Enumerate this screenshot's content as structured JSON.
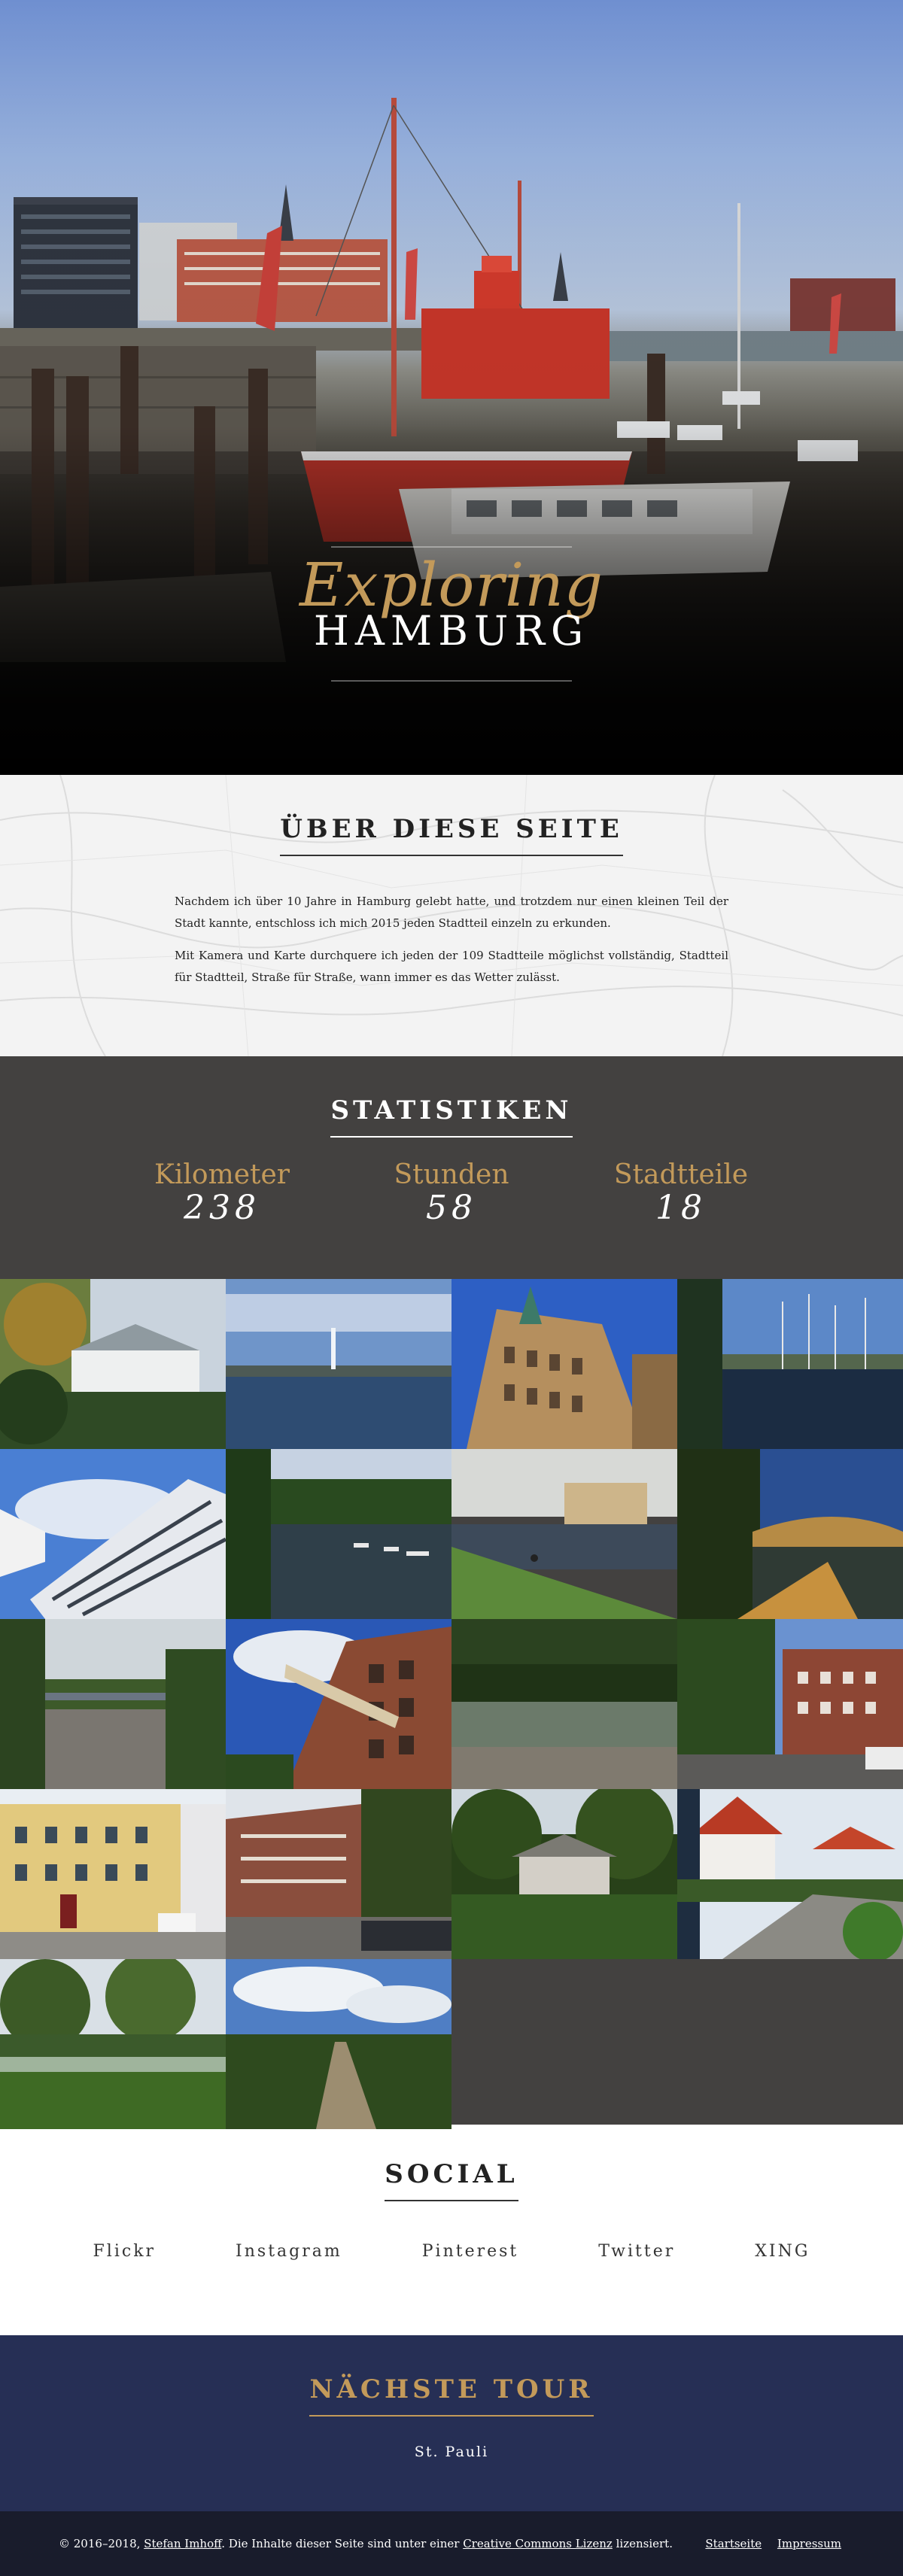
{
  "hero": {
    "script_title": "Exploring",
    "main_title": "HAMBURG"
  },
  "about": {
    "title": "ÜBER DIESE SEITE",
    "paragraphs": [
      "Nachdem ich über 10 Jahre in Hamburg gelebt hatte, und trotzdem nur einen kleinen Teil der Stadt kannte, entschloss ich mich 2015 jeden Stadtteil einzeln zu erkunden.",
      "Mit Kamera und Karte durchquere ich jeden der 109 Stadtteile möglichst vollständig, Stadtteil für Stadtteil, Straße für Straße, wann immer es das Wetter zulässt."
    ]
  },
  "stats": {
    "title": "STATISTIKEN",
    "items": [
      {
        "label": "Kilometer",
        "value": "238"
      },
      {
        "label": "Stunden",
        "value": "58"
      },
      {
        "label": "Stadtteile",
        "value": "18"
      }
    ]
  },
  "gallery": {
    "photos": [
      {
        "scene": "villa-trees"
      },
      {
        "scene": "alster-fountain"
      },
      {
        "scene": "rathaus"
      },
      {
        "scene": "marina"
      },
      {
        "scene": "office-building"
      },
      {
        "scene": "river-boats"
      },
      {
        "scene": "canal-meadow"
      },
      {
        "scene": "bridge-sunset"
      },
      {
        "scene": "railway-bridge"
      },
      {
        "scene": "brick-lettering"
      },
      {
        "scene": "park-pond"
      },
      {
        "scene": "brick-street"
      },
      {
        "scene": "yellow-house"
      },
      {
        "scene": "brick-block"
      },
      {
        "scene": "forest-cottage"
      },
      {
        "scene": "red-roof-street"
      },
      {
        "scene": "lake-park"
      },
      {
        "scene": "hedge-path"
      }
    ]
  },
  "social": {
    "title": "SOCIAL",
    "links": [
      "Flickr",
      "Instagram",
      "Pinterest",
      "Twitter",
      "XING"
    ]
  },
  "next_tour": {
    "title": "NÄCHSTE TOUR",
    "district": "St. Pauli"
  },
  "footer": {
    "copyright_prefix": "© 2016–2018,",
    "author": "Stefan Imhoff",
    "middle": ". Die Inhalte dieser Seite sind unter einer",
    "license": "Creative Commons Lizenz",
    "suffix": "lizensiert.",
    "nav": [
      "Startseite",
      "Impressum"
    ]
  },
  "colors": {
    "accent_gold": "#c39a5a",
    "dark_gray": "#434140",
    "navy": "#262f55",
    "footer_bg": "#191c2c"
  }
}
